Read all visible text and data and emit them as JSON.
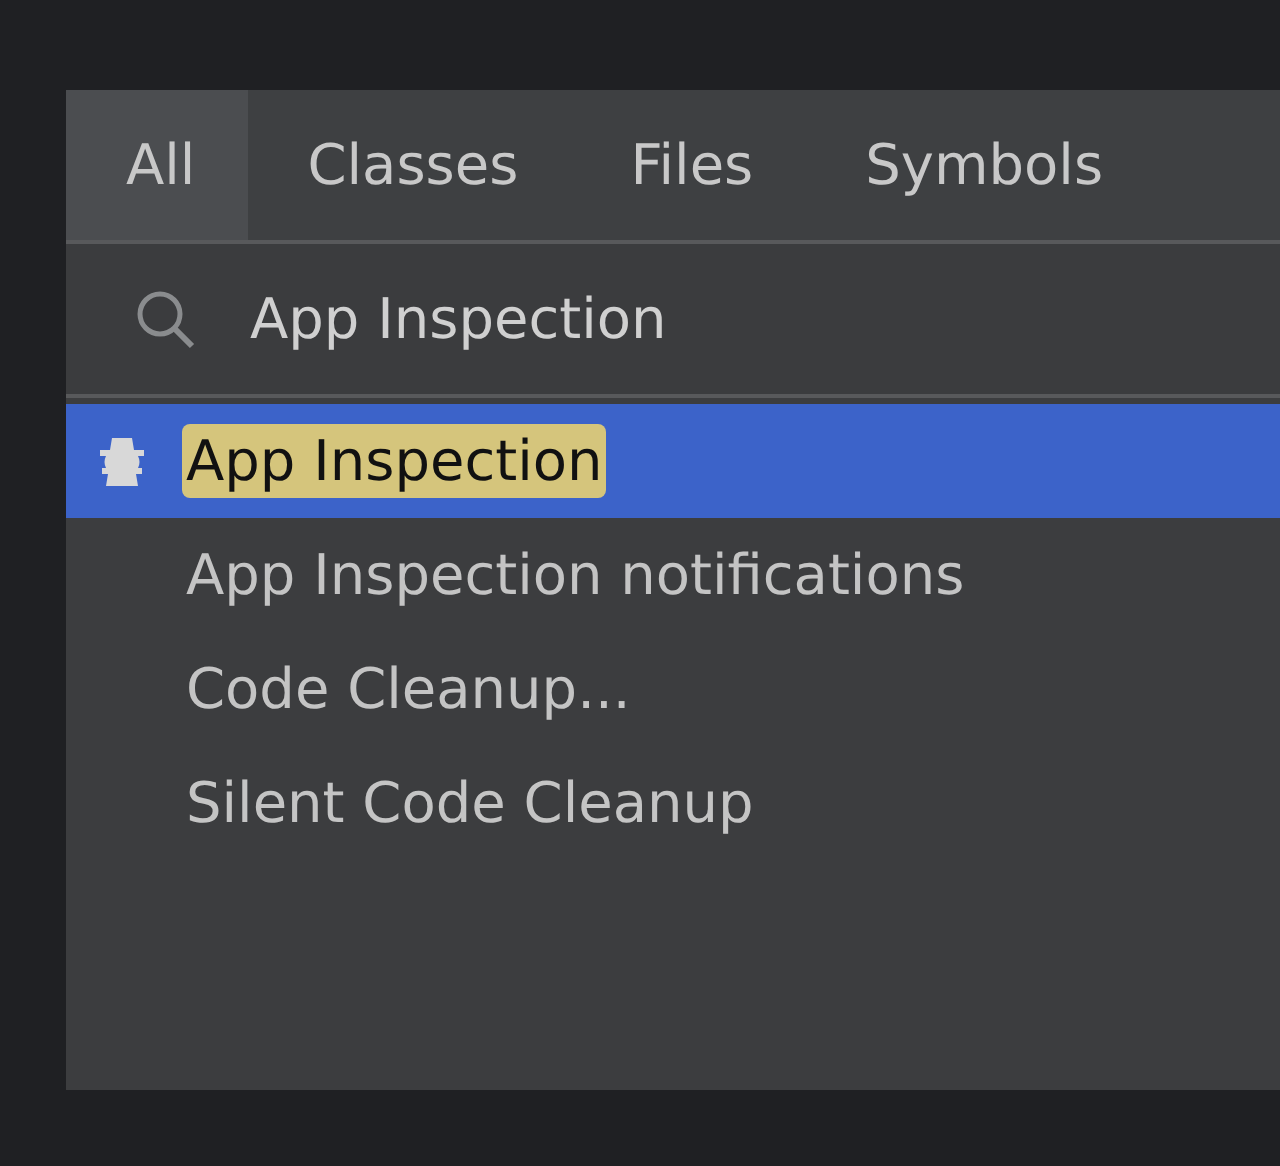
{
  "tabs": [
    {
      "label": "All",
      "selected": true
    },
    {
      "label": "Classes",
      "selected": false
    },
    {
      "label": "Files",
      "selected": false
    },
    {
      "label": "Symbols",
      "selected": false
    }
  ],
  "search": {
    "value": "App Inspection"
  },
  "results": [
    {
      "label": "App Inspection",
      "selected": true,
      "match_highlighted": true,
      "kind": "tool"
    },
    {
      "label": "App Inspection notifications",
      "selected": false,
      "match_highlighted": false,
      "kind": "plain"
    },
    {
      "label": "Code Cleanup...",
      "selected": false,
      "match_highlighted": false,
      "kind": "plain"
    },
    {
      "label": "Silent Code Cleanup",
      "selected": false,
      "match_highlighted": false,
      "kind": "plain"
    }
  ]
}
